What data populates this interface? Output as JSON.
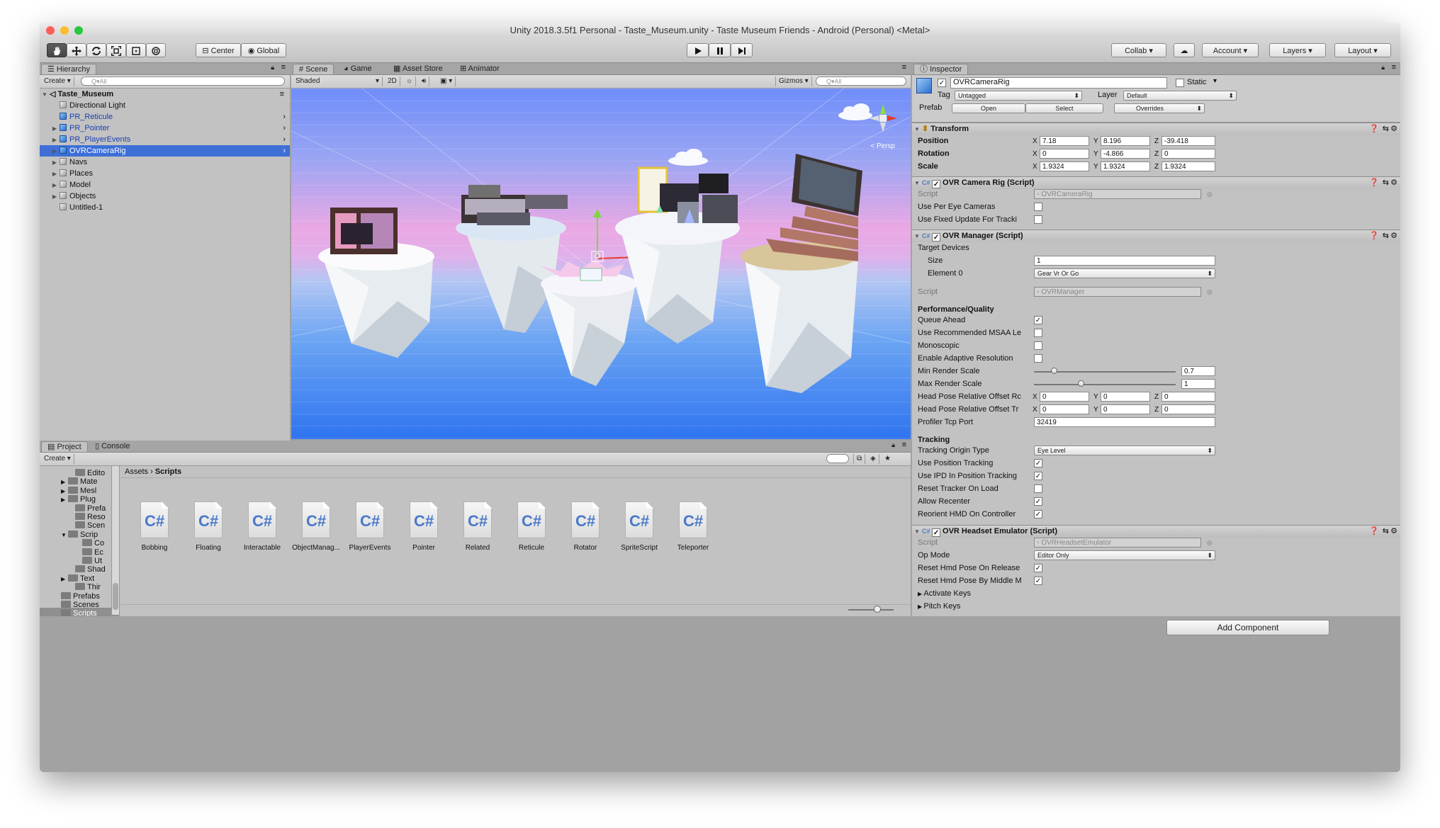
{
  "window": {
    "title": "Unity 2018.3.5f1 Personal - Taste_Museum.unity - Taste Museum Friends - Android (Personal) <Metal>",
    "colors": {
      "selection": "#3d6fd7",
      "panel": "#c2c2c2",
      "toolbar": "#cbcbcb"
    }
  },
  "toolbar": {
    "tools": [
      "hand-tool-icon",
      "move-tool-icon",
      "rotate-tool-icon",
      "scale-tool-icon",
      "rect-tool-icon",
      "transform-tool-icon"
    ],
    "pivot": "Center",
    "space": "Global",
    "collab": "Collab ▾",
    "account": "Account",
    "layers": "Layers",
    "layout": "Layout"
  },
  "hierarchy": {
    "tab": "Hierarchy",
    "create": "Create",
    "search_placeholder": "Q▾All",
    "scene": "Taste_Museum",
    "items": [
      {
        "label": "Directional Light",
        "icon": "gray",
        "expand": false,
        "arrow": false,
        "sel": false
      },
      {
        "label": "PR_Reticule",
        "icon": "blue",
        "expand": false,
        "arrow": true,
        "sel": false,
        "prefab": true
      },
      {
        "label": "PR_Pointer",
        "icon": "blue",
        "expand": true,
        "arrow": true,
        "sel": false,
        "prefab": true
      },
      {
        "label": "PR_PlayerEvents",
        "icon": "blue",
        "expand": true,
        "arrow": true,
        "sel": false,
        "prefab": true
      },
      {
        "label": "OVRCameraRig",
        "icon": "blue",
        "expand": true,
        "arrow": true,
        "sel": true,
        "prefab": true
      },
      {
        "label": "Navs",
        "icon": "gray",
        "expand": true,
        "arrow": false,
        "sel": false
      },
      {
        "label": "Places",
        "icon": "gray",
        "expand": true,
        "arrow": false,
        "sel": false
      },
      {
        "label": "Model",
        "icon": "gray",
        "expand": true,
        "arrow": false,
        "sel": false
      },
      {
        "label": "Objects",
        "icon": "gray",
        "expand": true,
        "arrow": false,
        "sel": false
      },
      {
        "label": "Untitled-1",
        "icon": "gray",
        "expand": false,
        "arrow": false,
        "sel": false
      }
    ]
  },
  "scene": {
    "tabs": [
      "Scene",
      "Game",
      "Asset Store",
      "Animator"
    ],
    "shading": "Shaded",
    "mode_2d": "2D",
    "gizmos": "Gizmos",
    "search_placeholder": "Q▾All",
    "gizmo_label": "< Persp"
  },
  "project": {
    "tabs": [
      "Project",
      "Console"
    ],
    "create": "Create",
    "breadcrumb": [
      "Assets",
      "Scripts"
    ],
    "tree": [
      {
        "label": "Edito",
        "indent": 2,
        "expand": false
      },
      {
        "label": "Mate",
        "indent": 1,
        "expand": true
      },
      {
        "label": "Mesl",
        "indent": 1,
        "expand": true
      },
      {
        "label": "Plug",
        "indent": 1,
        "expand": true
      },
      {
        "label": "Prefa",
        "indent": 2,
        "expand": false
      },
      {
        "label": "Reso",
        "indent": 2,
        "expand": false
      },
      {
        "label": "Scen",
        "indent": 2,
        "expand": false
      },
      {
        "label": "Scrip",
        "indent": 1,
        "expand": true,
        "open": true
      },
      {
        "label": "Co",
        "indent": 3,
        "expand": false
      },
      {
        "label": "Ec",
        "indent": 3,
        "expand": false
      },
      {
        "label": "Ut",
        "indent": 3,
        "expand": false
      },
      {
        "label": "Shad",
        "indent": 2,
        "expand": false
      },
      {
        "label": "Text",
        "indent": 1,
        "expand": true
      },
      {
        "label": "Thir",
        "indent": 2,
        "expand": false
      },
      {
        "label": "Prefabs",
        "indent": 0,
        "expand": false
      },
      {
        "label": "Scenes",
        "indent": 0,
        "expand": false
      },
      {
        "label": "Scripts",
        "indent": 0,
        "expand": false,
        "sel": true
      }
    ],
    "assets": [
      "Bobbing",
      "Floating",
      "Interactable",
      "ObjectManag...",
      "PlayerEvents",
      "Pointer",
      "Related",
      "Reticule",
      "Rotator",
      "SpriteScript",
      "Teleporter"
    ],
    "file_icon_text": "C#"
  },
  "inspector": {
    "tab": "Inspector",
    "object_name": "OVRCameraRig",
    "static_label": "Static",
    "tag_label": "Tag",
    "tag_value": "Untagged",
    "layer_label": "Layer",
    "layer_value": "Default",
    "prefab_label": "Prefab",
    "prefab_open": "Open",
    "prefab_select": "Select",
    "prefab_overrides": "Overrides",
    "transform": {
      "title": "Transform",
      "position": {
        "label": "Position",
        "x": "7.18",
        "y": "8.196",
        "z": "-39.418"
      },
      "rotation": {
        "label": "Rotation",
        "x": "0",
        "y": "-4.866",
        "z": "0"
      },
      "scale": {
        "label": "Scale",
        "x": "1.9324",
        "y": "1.9324",
        "z": "1.9324"
      }
    },
    "camera_rig": {
      "title": "OVR Camera Rig (Script)",
      "script_label": "Script",
      "script_value": "OVRCameraRig",
      "per_eye": "Use Per Eye Cameras",
      "fixed_update": "Use Fixed Update For Tracki"
    },
    "manager": {
      "title": "OVR Manager (Script)",
      "target_devices": "Target Devices",
      "size_label": "Size",
      "size_value": "1",
      "element0_label": "Element 0",
      "element0_value": "Gear Vr Or Go",
      "script_label": "Script",
      "script_value": "OVRManager",
      "perf_header": "Performance/Quality",
      "queue_ahead": "Queue Ahead",
      "msaa": "Use Recommended MSAA Le",
      "monoscopic": "Monoscopic",
      "adaptive": "Enable Adaptive Resolution",
      "min_render": "Min Render Scale",
      "min_render_value": "0.7",
      "min_render_fraction": 0.14,
      "max_render": "Max Render Scale",
      "max_render_value": "1",
      "max_render_fraction": 0.33,
      "head_rot": "Head Pose Relative Offset Rc",
      "head_trans": "Head Pose Relative Offset Tr",
      "head_rot_xyz": [
        "0",
        "0",
        "0"
      ],
      "head_trans_xyz": [
        "0",
        "0",
        "0"
      ],
      "profiler": "Profiler Tcp Port",
      "profiler_value": "32419",
      "tracking_header": "Tracking",
      "origin": "Tracking Origin Type",
      "origin_value": "Eye Level",
      "pos_tracking": "Use Position Tracking",
      "ipd": "Use IPD In Position Tracking",
      "reset_tracker": "Reset Tracker On Load",
      "recenter": "Allow Recenter",
      "reorient": "Reorient HMD On Controller"
    },
    "emulator": {
      "title": "OVR Headset Emulator (Script)",
      "script_label": "Script",
      "script_value": "OVRHeadsetEmulator",
      "op_mode": "Op Mode",
      "op_mode_value": "Editor Only",
      "reset_release": "Reset Hmd Pose On Release",
      "reset_middle": "Reset Hmd Pose By Middle M",
      "activate_keys": "Activate Keys",
      "pitch_keys": "Pitch Keys"
    },
    "add_component": "Add Component"
  }
}
